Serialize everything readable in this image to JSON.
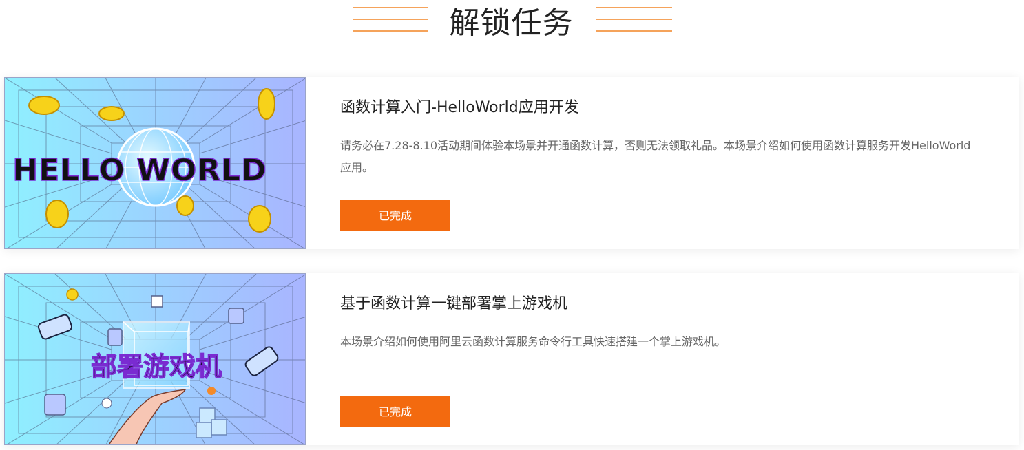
{
  "header": {
    "title": "解锁任务",
    "accent_color": "#f5a35b"
  },
  "tasks": [
    {
      "thumb_text": "HELLO WORLD",
      "title": "函数计算入门-HelloWorld应用开发",
      "description": "请务必在7.28-8.10活动期间体验本场景并开通函数计算，否则无法领取礼品。本场景介绍如何使用函数计算服务开发HelloWorld应用。",
      "button_label": "已完成"
    },
    {
      "thumb_text": "部署游戏机",
      "title": "基于函数计算一键部署掌上游戏机",
      "description": "本场景介绍如何使用阿里云函数计算服务命令行工具快速搭建一个掌上游戏机。",
      "button_label": "已完成"
    }
  ],
  "colors": {
    "button": "#f36a0f",
    "thumb_gradient_start": "#8ff0ff",
    "thumb_gradient_end": "#a9b4ff"
  }
}
